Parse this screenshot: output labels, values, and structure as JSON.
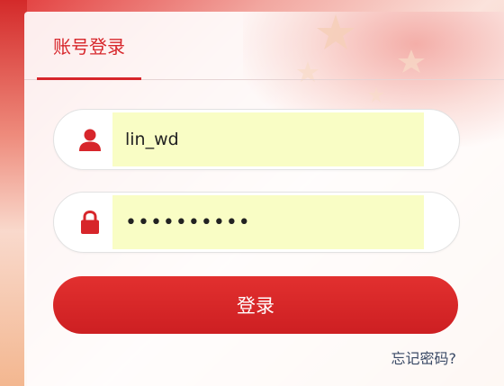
{
  "login": {
    "tab_label": "账号登录",
    "username_value": "lin_wd",
    "password_value": "••••••••••",
    "submit_label": "登录",
    "forgot_label": "忘记密码?"
  },
  "colors": {
    "accent": "#d7262b",
    "autofill_bg": "#f9fdc5"
  },
  "icons": {
    "username": "user-icon",
    "password": "lock-icon"
  }
}
